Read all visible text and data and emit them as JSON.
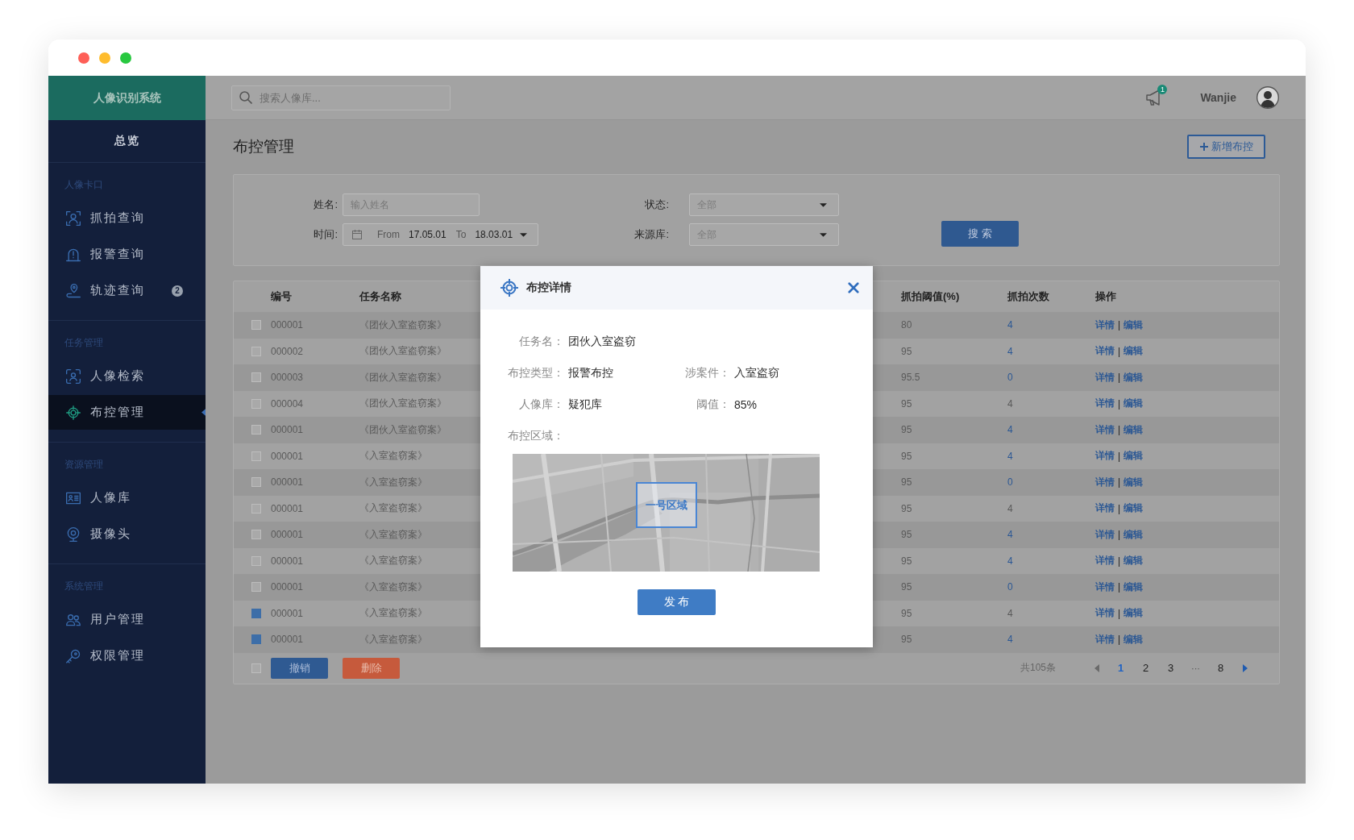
{
  "sidebar": {
    "logo": "人像识别系统",
    "overview": "总览",
    "sections": [
      {
        "title": "人像卡口",
        "items": [
          {
            "label": "抓拍查询",
            "selected": false
          },
          {
            "label": "报警查询",
            "selected": false
          },
          {
            "label": "轨迹查询",
            "selected": false,
            "badge": "2"
          }
        ]
      },
      {
        "title": "任务管理",
        "items": [
          {
            "label": "人像检索",
            "selected": false
          },
          {
            "label": "布控管理",
            "selected": true
          }
        ]
      },
      {
        "title": "资源管理",
        "items": [
          {
            "label": "人像库",
            "selected": false
          },
          {
            "label": "摄像头",
            "selected": false
          }
        ]
      },
      {
        "title": "系统管理",
        "items": [
          {
            "label": "用户管理",
            "selected": false
          },
          {
            "label": "权限管理",
            "selected": false
          }
        ]
      }
    ]
  },
  "top_bar": {
    "search": {
      "placeholder": "搜索人像库..."
    },
    "notification_count": "1",
    "user_name": "Wanjie"
  },
  "page": {
    "title": "布控管理",
    "add_button": "新增布控"
  },
  "filters": {
    "name": {
      "label": "姓名:",
      "placeholder": "输入姓名"
    },
    "time": {
      "label": "时间:",
      "from_label": "From",
      "from": "17.05.01",
      "to_label": "To",
      "to": "18.03.01"
    },
    "status": {
      "label": "状态:",
      "placeholder": "全部"
    },
    "source": {
      "label": "来源库:",
      "placeholder": "全部"
    },
    "search_button": "搜 索"
  },
  "table": {
    "columns": [
      "编号",
      "任务名称",
      "抓拍阈值(%)",
      "抓拍次数",
      "操作"
    ],
    "rows": [
      {
        "checked": false,
        "id": "000001",
        "task": "《团伙入室盗窃案》",
        "threshold": "80",
        "count": "4",
        "count_link": true,
        "actions": [
          "详情",
          "编辑"
        ],
        "separator": "|"
      },
      {
        "checked": false,
        "id": "000002",
        "task": "《团伙入室盗窃案》",
        "threshold": "95",
        "count": "4",
        "count_link": true,
        "actions": [
          "详情",
          "编辑"
        ],
        "separator": "|"
      },
      {
        "checked": false,
        "id": "000003",
        "task": "《团伙入室盗窃案》",
        "threshold": "95.5",
        "count": "0",
        "count_link": true,
        "actions": [
          "详情",
          "编辑"
        ],
        "separator": "|"
      },
      {
        "checked": false,
        "id": "000004",
        "task": "《团伙入室盗窃案》",
        "threshold": "95",
        "count": "4",
        "count_link": false,
        "actions": [
          "详情",
          "编辑"
        ],
        "separator": "|"
      },
      {
        "checked": false,
        "id": "000001",
        "task": "《团伙入室盗窃案》",
        "threshold": "95",
        "count": "4",
        "count_link": true,
        "actions": [
          "详情",
          "编辑"
        ],
        "separator": "|"
      },
      {
        "checked": false,
        "id": "000001",
        "task": "《入室盗窃案》",
        "threshold": "95",
        "count": "4",
        "count_link": true,
        "actions": [
          "详情",
          "编辑"
        ],
        "separator": "|"
      },
      {
        "checked": false,
        "id": "000001",
        "task": "《入室盗窃案》",
        "threshold": "95",
        "count": "0",
        "count_link": true,
        "actions": [
          "详情",
          "编辑"
        ],
        "separator": "|"
      },
      {
        "checked": false,
        "id": "000001",
        "task": "《入室盗窃案》",
        "threshold": "95",
        "count": "4",
        "count_link": false,
        "actions": [
          "详情",
          "编辑"
        ],
        "separator": "|"
      },
      {
        "checked": false,
        "id": "000001",
        "task": "《入室盗窃案》",
        "threshold": "95",
        "count": "4",
        "count_link": true,
        "actions": [
          "详情",
          "编辑"
        ],
        "separator": "|"
      },
      {
        "checked": false,
        "id": "000001",
        "task": "《入室盗窃案》",
        "threshold": "95",
        "count": "4",
        "count_link": true,
        "actions": [
          "详情",
          "编辑"
        ],
        "separator": "|"
      },
      {
        "checked": false,
        "id": "000001",
        "task": "《入室盗窃案》",
        "threshold": "95",
        "count": "0",
        "count_link": true,
        "actions": [
          "详情",
          "编辑"
        ],
        "separator": "|"
      },
      {
        "checked": true,
        "id": "000001",
        "task": "《入室盗窃案》",
        "threshold": "95",
        "count": "4",
        "count_link": false,
        "actions": [
          "详情",
          "编辑"
        ],
        "separator": "|"
      },
      {
        "checked": true,
        "id": "000001",
        "task": "《入室盗窃案》",
        "threshold": "95",
        "count": "4",
        "count_link": true,
        "actions": [
          "详情",
          "编辑"
        ],
        "separator": "|"
      }
    ],
    "footer": {
      "select_all_checked": false,
      "cancel_button": "撤销",
      "delete_button": "删除",
      "total": "共105条",
      "prev_disabled": true,
      "next_disabled": false,
      "pages": [
        {
          "kind": "page",
          "label": "1",
          "selected": true
        },
        {
          "kind": "page",
          "label": "2",
          "selected": false
        },
        {
          "kind": "page",
          "label": "3",
          "selected": false
        },
        {
          "kind": "ellipsis",
          "label": "···"
        },
        {
          "kind": "page",
          "label": "8",
          "selected": false
        }
      ]
    }
  },
  "modal": {
    "title": "布控详情",
    "rows": [
      [
        {
          "label": "任务名：",
          "value": "团伙入室盗窃"
        }
      ],
      [
        {
          "label": "布控类型：",
          "value": "报警布控"
        },
        {
          "label": "涉案件：",
          "value": "入室盗窃"
        }
      ],
      [
        {
          "label": "人像库：",
          "value": "疑犯库"
        },
        {
          "label": "阈值：",
          "value": "85%"
        }
      ]
    ],
    "area_label": "布控区域：",
    "map": {
      "region_label": "一号区域"
    },
    "publish_button": "发 布"
  }
}
